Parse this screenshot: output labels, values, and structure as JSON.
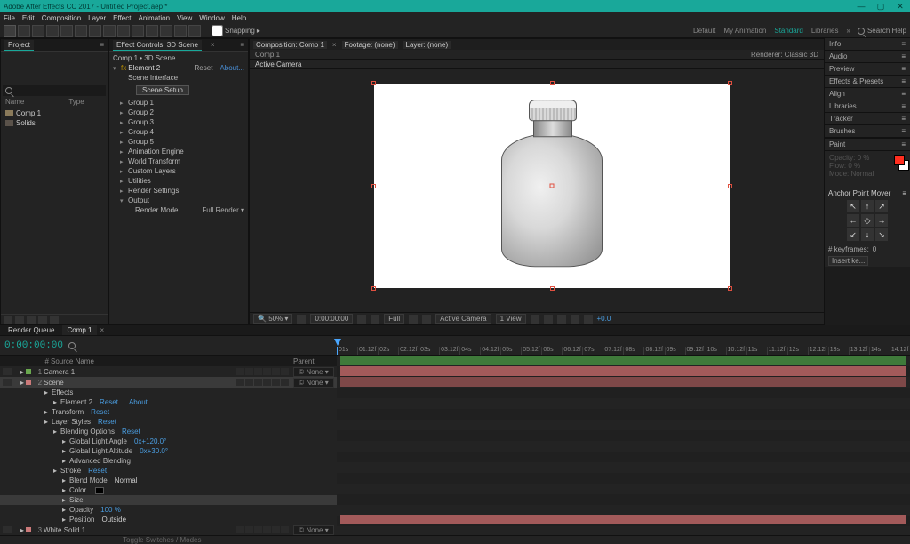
{
  "app": {
    "title": "Adobe After Effects CC 2017 - Untitled Project.aep *"
  },
  "menubar": [
    "File",
    "Edit",
    "Composition",
    "Layer",
    "Effect",
    "Animation",
    "View",
    "Window",
    "Help"
  ],
  "toolbar": {
    "snapping_label": "Snapping",
    "workspaces": [
      {
        "label": "Default",
        "active": false
      },
      {
        "label": "My Animation",
        "active": false
      },
      {
        "label": "Standard",
        "active": true
      },
      {
        "label": "Libraries",
        "active": false
      }
    ],
    "search_placeholder": "Search Help"
  },
  "project_panel": {
    "tab": "Project",
    "col_name": "Name",
    "col_type": "Type",
    "items": [
      {
        "name": "Comp 1",
        "kind": "comp"
      },
      {
        "name": "Solids",
        "kind": "folder"
      }
    ]
  },
  "effect_controls": {
    "tab": "Effect Controls: 3D Scene",
    "header": "Comp 1 • 3D Scene",
    "effect_name": "Element 2",
    "reset": "Reset",
    "about": "About...",
    "rows": [
      {
        "t": "Scene Interface",
        "l": 1
      },
      {
        "t": "Scene Setup",
        "btn": true,
        "l": 2
      },
      {
        "t": "Group 1",
        "l": 1,
        "tw": ">"
      },
      {
        "t": "Group 2",
        "l": 1,
        "tw": ">"
      },
      {
        "t": "Group 3",
        "l": 1,
        "tw": ">"
      },
      {
        "t": "Group 4",
        "l": 1,
        "tw": ">"
      },
      {
        "t": "Group 5",
        "l": 1,
        "tw": ">"
      },
      {
        "t": "Animation Engine",
        "l": 1,
        "tw": ">"
      },
      {
        "t": "World Transform",
        "l": 1,
        "tw": ">"
      },
      {
        "t": "Custom Layers",
        "l": 1,
        "tw": ">"
      },
      {
        "t": "Utilities",
        "l": 1,
        "tw": ">"
      },
      {
        "t": "Render Settings",
        "l": 1,
        "tw": ">"
      },
      {
        "t": "Output",
        "l": 1,
        "tw": "v"
      },
      {
        "t": "Render Mode",
        "l": 2,
        "v": "Full Render"
      }
    ]
  },
  "composition": {
    "tabs": [
      {
        "label": "Composition: Comp 1",
        "sel": true
      },
      {
        "label": "Footage: (none)"
      },
      {
        "label": "Layer: (none)"
      }
    ],
    "breadcrumb": "Comp 1",
    "active_camera_label": "Active Camera",
    "renderer": "Renderer: Classic 3D",
    "footer": {
      "magnification": "50%",
      "timecode": "0:00:00:00",
      "resolution": "Full",
      "camera": "Active Camera",
      "views": "1 View",
      "exposure": "+0.0"
    }
  },
  "right_panels": [
    "Info",
    "Audio",
    "Preview",
    "Effects & Presets",
    "Align",
    "Libraries",
    "Tracker",
    "Brushes"
  ],
  "paint": {
    "label": "Paint",
    "opacity": "Opacity: 0 %",
    "flow": "Flow: 0 %",
    "mode": "Mode: Normal"
  },
  "anchor_move": {
    "title": "Anchor Point Mover"
  },
  "keyframes": {
    "label": "# keyframes:",
    "value": "0",
    "insert": "Insert ke..."
  },
  "timeline": {
    "tabs": [
      {
        "label": "Render Queue",
        "sel": false
      },
      {
        "label": "Comp 1",
        "sel": true
      }
    ],
    "timecode": "0:00:00:00",
    "source_label": "Source Name",
    "parent_none": "None",
    "ruler_ticks": [
      "01s",
      "01:12f",
      "02s",
      "02:12f",
      "03s",
      "03:12f",
      "04s",
      "04:12f",
      "05s",
      "05:12f",
      "06s",
      "06:12f",
      "07s",
      "07:12f",
      "08s",
      "08:12f",
      "09s",
      "09:12f",
      "10s",
      "10:12f",
      "11s",
      "11:12f",
      "12s",
      "12:12f",
      "13s",
      "13:12f",
      "14s",
      "14:12f"
    ],
    "layers": [
      {
        "num": "1",
        "name": "Camera 1",
        "color": "#6aa84f",
        "parent": "None"
      },
      {
        "num": "2",
        "name": "Scene",
        "color": "#cc7a7a",
        "parent": "None",
        "sel": true
      }
    ],
    "props": [
      {
        "name": "Effects",
        "lvl": 1
      },
      {
        "name": "Element 2",
        "lvl": 2,
        "val": "Reset",
        "valc": "#4a9de0",
        "extra": "About..."
      },
      {
        "name": "Transform",
        "lvl": 1,
        "val": "Reset",
        "valc": "#4a9de0"
      },
      {
        "name": "Layer Styles",
        "lvl": 1,
        "val": "Reset",
        "valc": "#4a9de0"
      },
      {
        "name": "Blending Options",
        "lvl": 2,
        "val": "Reset",
        "valc": "#4a9de0"
      },
      {
        "name": "Global Light Angle",
        "lvl": 3,
        "val": "0x+120.0°",
        "valc": "#4a9de0"
      },
      {
        "name": "Global Light Altitude",
        "lvl": 3,
        "val": "0x+30.0°",
        "valc": "#4a9de0"
      },
      {
        "name": "Advanced Blending",
        "lvl": 3
      },
      {
        "name": "Stroke",
        "lvl": 2,
        "val": "Reset",
        "valc": "#4a9de0"
      },
      {
        "name": "Blend Mode",
        "lvl": 3,
        "val": "Normal",
        "valc": "#ccc"
      },
      {
        "name": "Color",
        "lvl": 3,
        "swatch": "#000"
      },
      {
        "name": "Size",
        "lvl": 3,
        "val": "",
        "sel": true
      },
      {
        "name": "Opacity",
        "lvl": 3,
        "val": "100 %",
        "valc": "#4a9de0"
      },
      {
        "name": "Position",
        "lvl": 3,
        "val": "Outside",
        "valc": "#ccc"
      }
    ],
    "layer3": {
      "num": "3",
      "name": "White Solid 1",
      "color": "#cc7a7a",
      "parent": "None"
    },
    "foot_hint": "Toggle Switches / Modes"
  }
}
